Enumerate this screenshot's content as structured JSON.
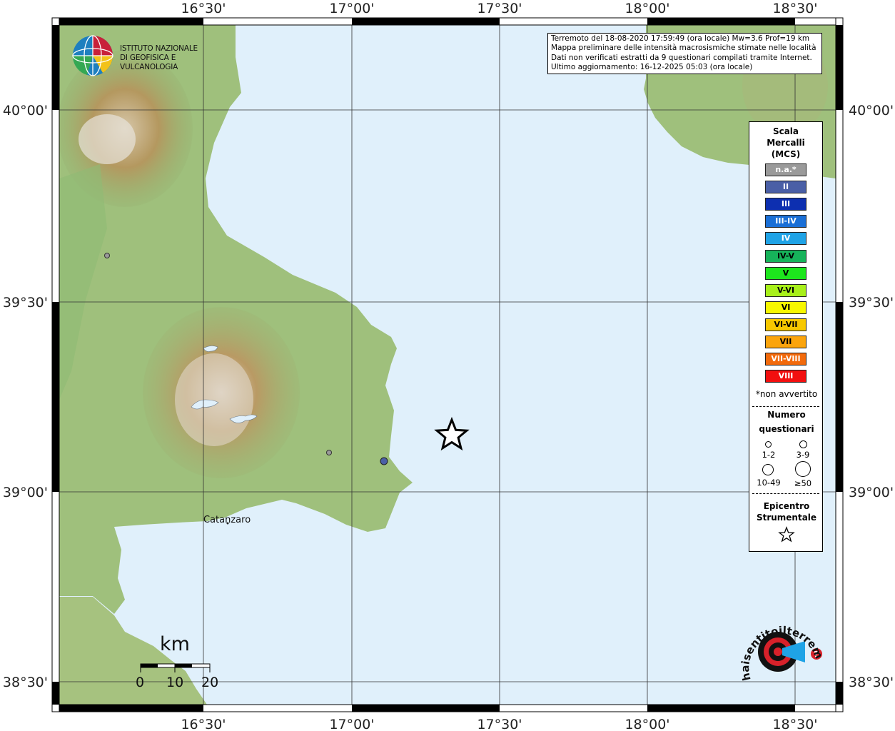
{
  "info": {
    "line1": "Terremoto del 18-08-2020 17:59:49 (ora locale) Mw=3.6 Prof=19 km",
    "line2": "Mappa preliminare delle intensità macrosismiche stimate nelle località",
    "line3": "Dati non verificati estratti da 9 questionari compilati tramite Internet.",
    "line4": "Ultimo aggiornamento: 16-12-2025 05:03 (ora locale)"
  },
  "ingv": {
    "line1": "ISTITUTO NAZIONALE",
    "line2": "DI GEOFISICA E VULCANOLOGIA"
  },
  "axes": {
    "lon_labels": [
      "16°30'",
      "17°00'",
      "17°30'",
      "18°00'",
      "18°30'"
    ],
    "lat_labels": [
      "40°00'",
      "39°30'",
      "39°00'",
      "38°30'"
    ]
  },
  "legend": {
    "scale_title": [
      "Scala",
      "Mercalli",
      "(MCS)"
    ],
    "levels": [
      {
        "label": "n.a.*",
        "color": "#9a9a9a"
      },
      {
        "label": "II",
        "color": "#4a5fa6"
      },
      {
        "label": "III",
        "color": "#0d2fb0"
      },
      {
        "label": "III-IV",
        "color": "#1a6fd6"
      },
      {
        "label": "IV",
        "color": "#1fa3e6"
      },
      {
        "label": "IV-V",
        "color": "#16b35a"
      },
      {
        "label": "V",
        "color": "#1de61d"
      },
      {
        "label": "V-VI",
        "color": "#a8f01a"
      },
      {
        "label": "VI",
        "color": "#f7f700"
      },
      {
        "label": "VI-VII",
        "color": "#f7c800"
      },
      {
        "label": "VII",
        "color": "#fba40c"
      },
      {
        "label": "VII-VIII",
        "color": "#f26a0c"
      },
      {
        "label": "VIII",
        "color": "#f20f0f"
      }
    ],
    "na_note": "*non avvertito",
    "count_title": [
      "Numero",
      "questionari"
    ],
    "count_bins": [
      "1-2",
      "3-9",
      "10-49",
      "≥50"
    ],
    "epi_title": [
      "Epicentro",
      "Strumentale"
    ]
  },
  "scalebar": {
    "unit": "km",
    "ticks": [
      "0",
      "10",
      "20"
    ]
  },
  "places": {
    "catanzaro": "Catanzaro"
  },
  "logo": {
    "text": "haisentitoilterremoto.it"
  },
  "observations": [
    {
      "level": "n.a.*",
      "count_bin": "1-2"
    },
    {
      "level": "n.a.*",
      "count_bin": "1-2"
    },
    {
      "level": "II",
      "count_bin": "1-2"
    }
  ],
  "epicenter": {
    "symbol": "star"
  }
}
